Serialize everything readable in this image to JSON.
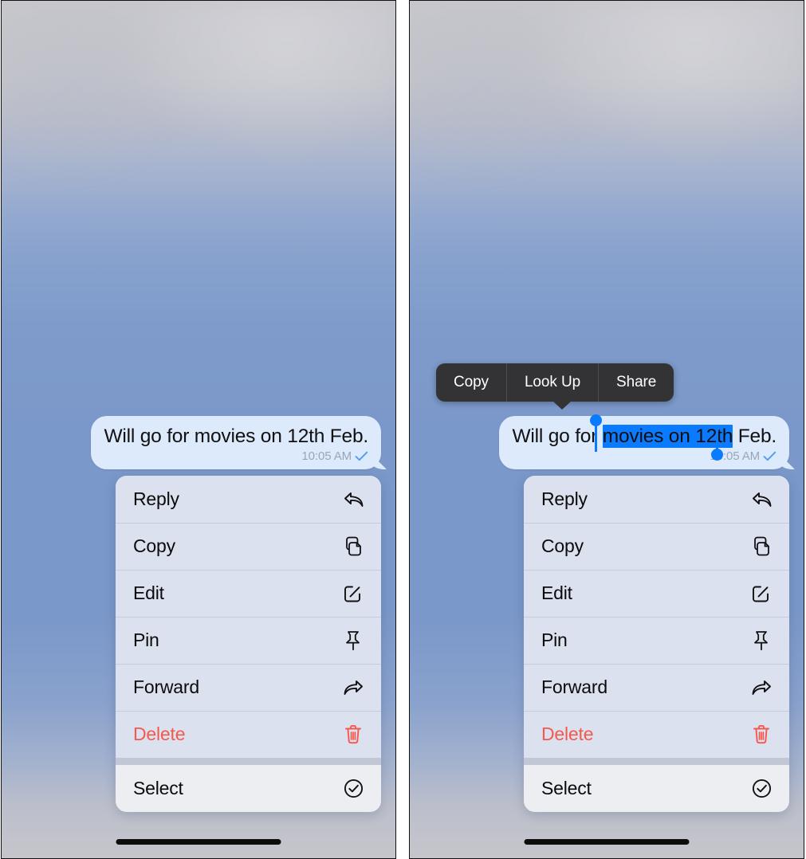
{
  "screens": [
    {
      "name": "left-screen",
      "message": {
        "text": "Will go for movies on 12th Feb.",
        "time": "10:05 AM",
        "delivered_icon": "checkmark-icon"
      },
      "selection_active": false,
      "context_menu": {
        "items": [
          {
            "label": "Reply",
            "icon": "reply-arrow-icon",
            "style": "normal"
          },
          {
            "label": "Copy",
            "icon": "copy-pages-icon",
            "style": "normal"
          },
          {
            "label": "Edit",
            "icon": "edit-pencil-icon",
            "style": "normal"
          },
          {
            "label": "Pin",
            "icon": "pushpin-icon",
            "style": "normal"
          },
          {
            "label": "Forward",
            "icon": "forward-arrow-icon",
            "style": "normal"
          },
          {
            "label": "Delete",
            "icon": "trash-icon",
            "style": "danger"
          }
        ],
        "footer_items": [
          {
            "label": "Select",
            "icon": "check-circle-icon",
            "style": "normal"
          }
        ]
      }
    },
    {
      "name": "right-screen",
      "message": {
        "text": "Will go for movies on 12th Feb.",
        "text_before_selection": "Will go for ",
        "text_selected": "movies on 12th",
        "text_after_selection": " Feb.",
        "time": "10:05 AM",
        "delivered_icon": "checkmark-icon"
      },
      "selection_active": true,
      "edit_toolbar": {
        "items": [
          {
            "label": "Copy"
          },
          {
            "label": "Look Up"
          },
          {
            "label": "Share"
          }
        ]
      },
      "context_menu": {
        "items": [
          {
            "label": "Reply",
            "icon": "reply-arrow-icon",
            "style": "normal"
          },
          {
            "label": "Copy",
            "icon": "copy-pages-icon",
            "style": "normal"
          },
          {
            "label": "Edit",
            "icon": "edit-pencil-icon",
            "style": "normal"
          },
          {
            "label": "Pin",
            "icon": "pushpin-icon",
            "style": "normal"
          },
          {
            "label": "Forward",
            "icon": "forward-arrow-icon",
            "style": "normal"
          },
          {
            "label": "Delete",
            "icon": "trash-icon",
            "style": "danger"
          }
        ],
        "footer_items": [
          {
            "label": "Select",
            "icon": "check-circle-icon",
            "style": "normal"
          }
        ]
      }
    }
  ],
  "colors": {
    "bubble_bg": "#dceafc",
    "menu_bg": "#dbe1ee",
    "menu_footer_bg": "#eceef2",
    "danger": "#f5594e",
    "selection_blue": "#0a7bff",
    "toolbar_bg": "#333336",
    "timestamp": "#9aa6b8"
  }
}
